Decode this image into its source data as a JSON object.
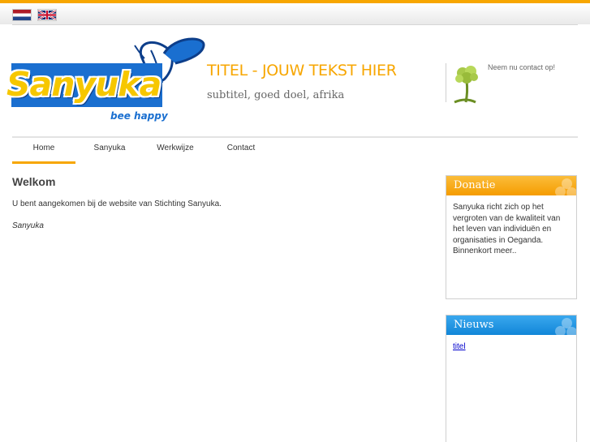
{
  "languages": [
    {
      "code": "nl",
      "icon": "flag-netherlands-icon"
    },
    {
      "code": "en",
      "icon": "flag-united-kingdom-icon"
    }
  ],
  "logo": {
    "name": "Sanyuka",
    "tagline": "bee happy"
  },
  "header": {
    "title": "TITEL - JOUW TEKST HIER",
    "subtitle": "subtitel, goed doel, afrika",
    "contact_link": "Neem nu contact op!"
  },
  "nav": {
    "items": [
      {
        "label": "Home",
        "active": true
      },
      {
        "label": "Sanyuka",
        "active": false
      },
      {
        "label": "Werkwijze",
        "active": false
      },
      {
        "label": "Contact",
        "active": false
      }
    ]
  },
  "main": {
    "heading": "Welkom",
    "paragraph": "U bent aangekomen bij de website van Stichting Sanyuka.",
    "signature": "Sanyuka"
  },
  "sidebar": {
    "donatie": {
      "title": "Donatie",
      "text": "Sanyuka richt zich op het vergroten van de kwaliteit van het leven van individuën en organisaties in Oeganda. Binnenkort meer.."
    },
    "nieuws": {
      "title": "Nieuws",
      "link": "titel"
    }
  },
  "colors": {
    "accent": "#f7a600",
    "blue": "#1a6fd0",
    "news_blue": "#1186d8"
  }
}
